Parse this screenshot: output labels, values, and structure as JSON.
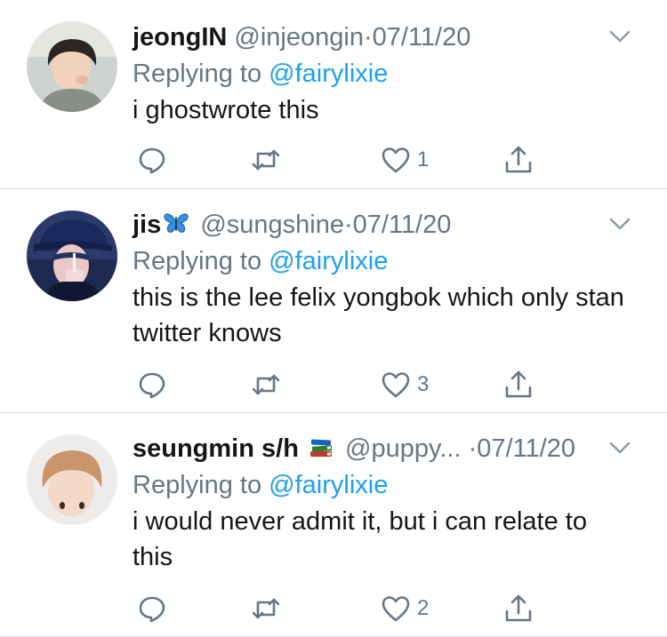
{
  "replying_prefix": "Replying to",
  "colors": {
    "accent": "#1da1f2",
    "secondary_text": "#657786",
    "divider": "#d8dde1"
  },
  "tweets": [
    {
      "name": "jeongIN",
      "name_emoji": "",
      "handle": "@injeongin",
      "separator": "·",
      "date": "07/11/20",
      "reply_to": "@fairylixie",
      "text": "i ghostwrote this",
      "like_count": "1",
      "icons": [
        "reply-icon",
        "retweet-icon",
        "heart-icon",
        "share-icon",
        "chevron-down-icon"
      ]
    },
    {
      "name": "jis",
      "name_emoji": "butterfly",
      "handle": "@sungshine",
      "separator": "·",
      "date": "07/11/20",
      "reply_to": "@fairylixie",
      "text": "this is the lee felix yongbok which only stan twitter knows",
      "like_count": "3"
    },
    {
      "name": "seungmin s/h",
      "name_emoji": "books",
      "handle": "@puppy...",
      "separator": "·",
      "date": "07/11/20",
      "reply_to": "@fairylixie",
      "text": "i would never admit it, but i can relate to this",
      "like_count": "2"
    }
  ]
}
